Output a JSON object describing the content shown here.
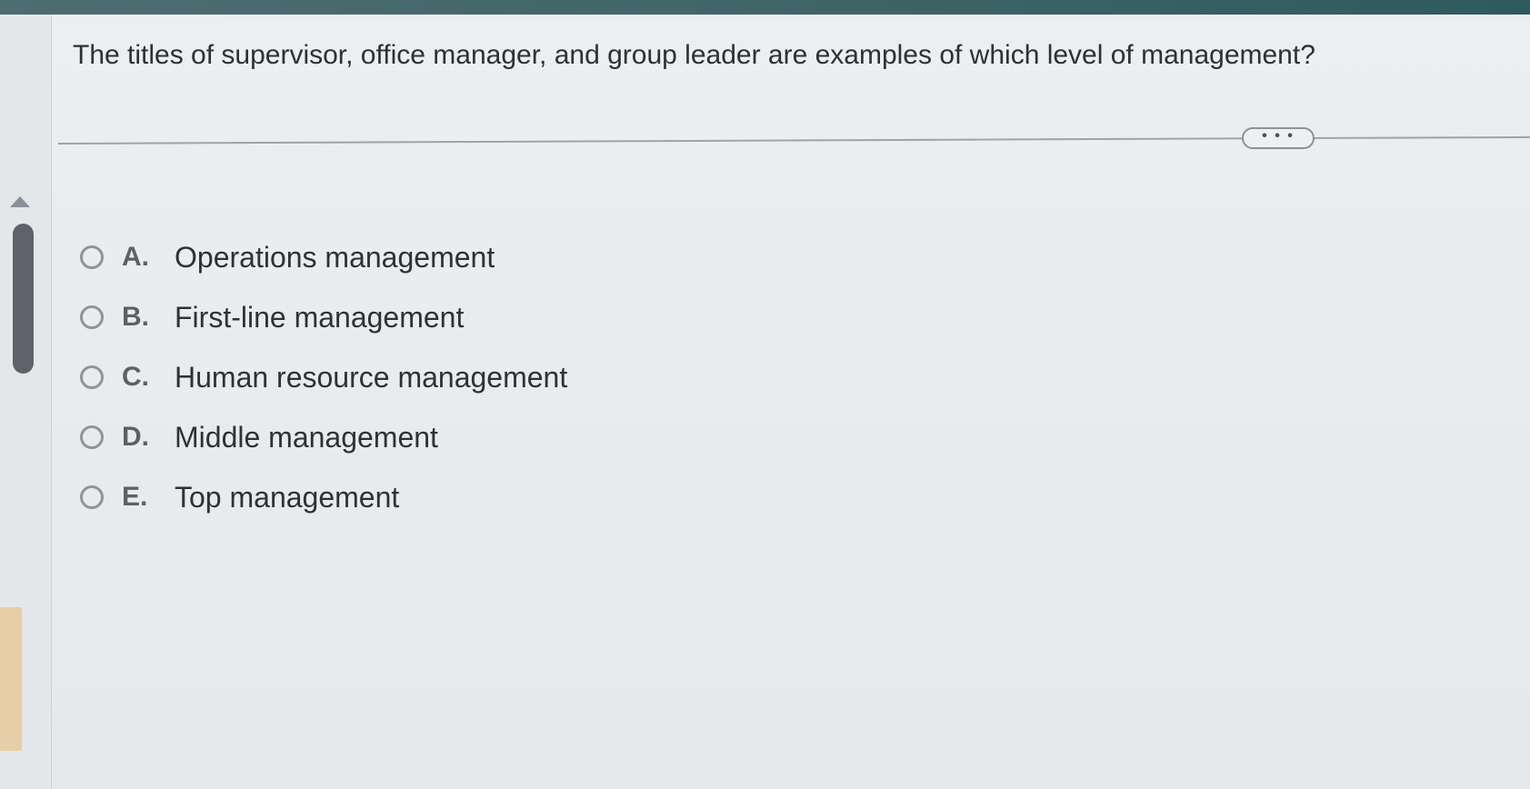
{
  "question": {
    "text": "The titles of supervisor, office manager, and group leader are examples of which level of management?"
  },
  "more_button": {
    "label": "• • •"
  },
  "options": [
    {
      "letter": "A.",
      "label": "Operations management",
      "selected": false
    },
    {
      "letter": "B.",
      "label": "First-line management",
      "selected": false
    },
    {
      "letter": "C.",
      "label": "Human resource management",
      "selected": false
    },
    {
      "letter": "D.",
      "label": "Middle management",
      "selected": false
    },
    {
      "letter": "E.",
      "label": "Top management",
      "selected": false
    }
  ],
  "icons": {
    "scroll_up": "triangle-up-icon",
    "radio": "radio-unselected-icon"
  },
  "colors": {
    "background": "#e9ecee",
    "text": "#2f3235",
    "accent_strip": "#3f6468"
  }
}
